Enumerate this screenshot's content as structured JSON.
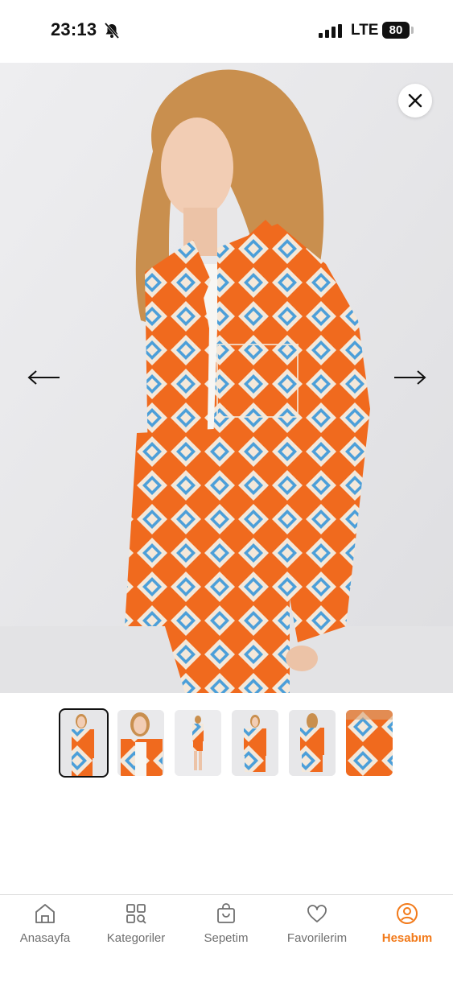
{
  "status_bar": {
    "time": "23:13",
    "network": "LTE",
    "battery": "80"
  },
  "product_gallery": {
    "thumbnail_count": 6,
    "active_index": 0,
    "icons": {
      "close": "close-icon",
      "prev": "arrow-left-icon",
      "next": "arrow-right-icon"
    }
  },
  "bottom_nav": {
    "accent_color": "#f27a1a",
    "items": [
      {
        "label": "Anasayfa",
        "icon": "home-icon"
      },
      {
        "label": "Kategoriler",
        "icon": "categories-icon"
      },
      {
        "label": "Sepetim",
        "icon": "shopping-bag-icon"
      },
      {
        "label": "Favorilerim",
        "icon": "heart-icon"
      },
      {
        "label": "Hesabım",
        "icon": "user-icon"
      }
    ]
  }
}
